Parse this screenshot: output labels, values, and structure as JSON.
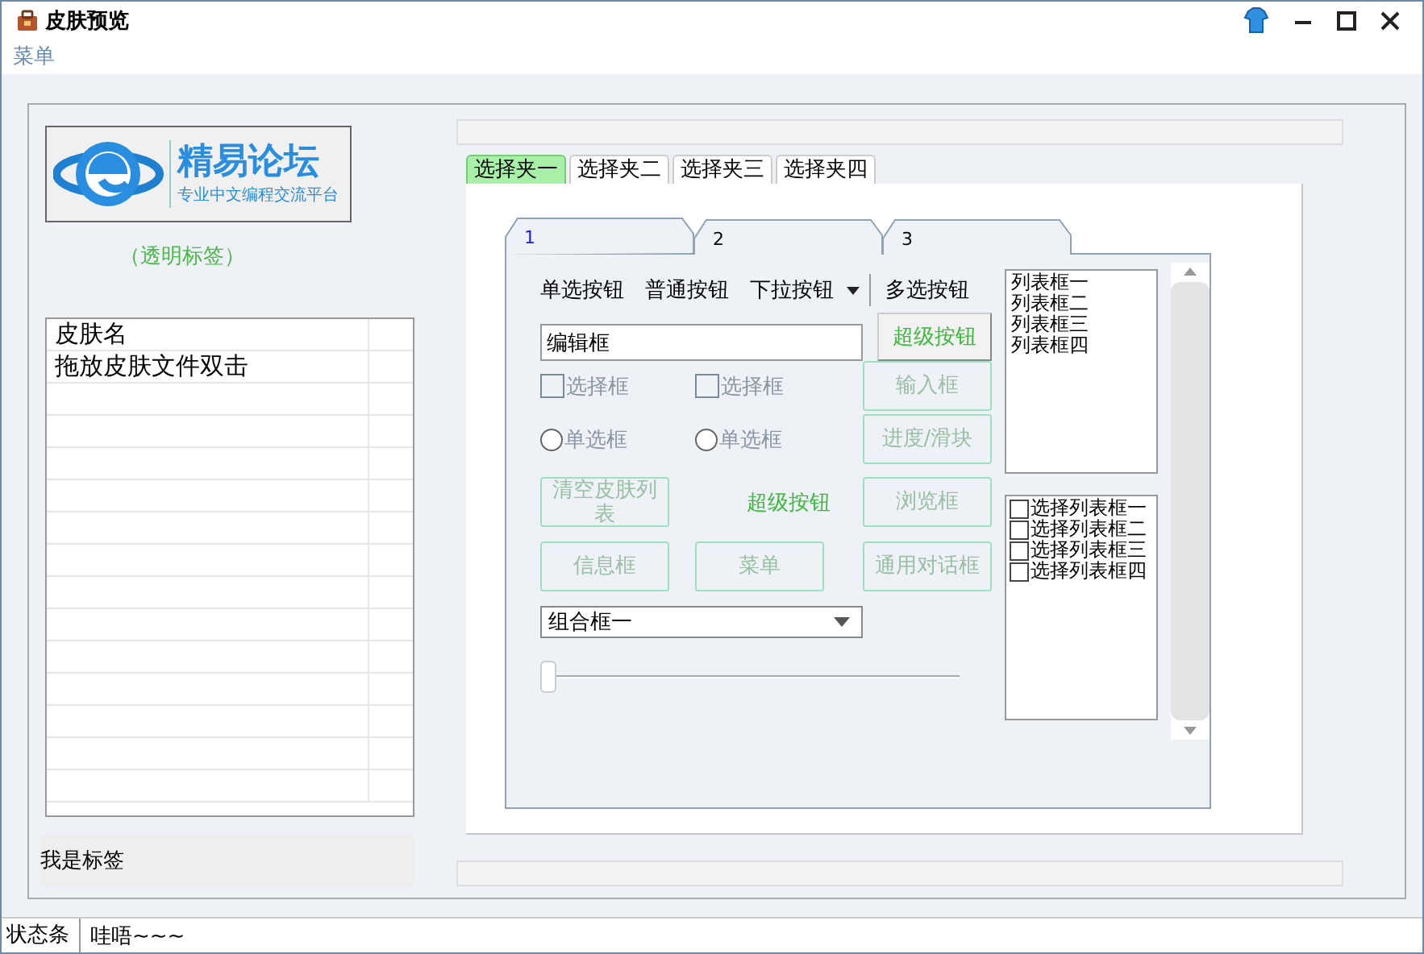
{
  "window": {
    "title": "皮肤预览"
  },
  "menu": [
    "菜单"
  ],
  "logo": {
    "title": "精易论坛",
    "subtitle": "专业中文编程交流平台"
  },
  "transparent_label": "（透明标签）",
  "skin_list": {
    "column": "皮肤名",
    "rows": [
      "拖放皮肤文件双击"
    ]
  },
  "label": "我是标签",
  "tabs": [
    {
      "label": "选择夹一",
      "selected": true
    },
    {
      "label": "选择夹二",
      "selected": false
    },
    {
      "label": "选择夹三",
      "selected": false
    },
    {
      "label": "选择夹四",
      "selected": false
    }
  ],
  "inner_tabs": [
    {
      "label": "1",
      "selected": true
    },
    {
      "label": "2",
      "selected": false
    },
    {
      "label": "3",
      "selected": false
    }
  ],
  "toolbar": [
    {
      "kind": "button",
      "label": "单选按钮"
    },
    {
      "kind": "button",
      "label": "普通按钮"
    },
    {
      "kind": "dropdown",
      "label": "下拉按钮"
    },
    {
      "kind": "button",
      "label": "多选按钮"
    }
  ],
  "form_rows": [
    [
      {
        "kind": "field",
        "value": "编辑框"
      },
      {
        "kind": "raised_button",
        "label": "超级按钮"
      }
    ],
    [
      {
        "kind": "checkbox",
        "label": "选择框",
        "checked": false
      },
      {
        "kind": "checkbox",
        "label": "选择框",
        "checked": false
      },
      {
        "kind": "button",
        "label": "输入框"
      }
    ],
    [
      {
        "kind": "radio",
        "label": "单选框",
        "selected": false
      },
      {
        "kind": "radio",
        "label": "单选框",
        "selected": false
      },
      {
        "kind": "button",
        "label": "进度/滑块"
      }
    ],
    [
      {
        "kind": "button",
        "label": "清空皮肤列表"
      },
      {
        "kind": "text_button",
        "label": "超级按钮"
      },
      {
        "kind": "button",
        "label": "浏览框"
      }
    ],
    [
      {
        "kind": "button",
        "label": "信息框"
      },
      {
        "kind": "button",
        "label": "菜单"
      },
      {
        "kind": "button",
        "label": "通用对话框"
      }
    ],
    [
      {
        "kind": "combo",
        "value": "组合框一"
      }
    ],
    [
      {
        "kind": "slider",
        "level": 0
      }
    ]
  ],
  "list_box": [
    "列表框一",
    "列表框二",
    "列表框三",
    "列表框四"
  ],
  "check_list": [
    {
      "label": "选择列表框一",
      "checked": false
    },
    {
      "label": "选择列表框二",
      "checked": false
    },
    {
      "label": "选择列表框三",
      "checked": false
    },
    {
      "label": "选择列表框四",
      "checked": false
    }
  ],
  "status_bar": [
    "状态条",
    "哇唔~~~"
  ]
}
